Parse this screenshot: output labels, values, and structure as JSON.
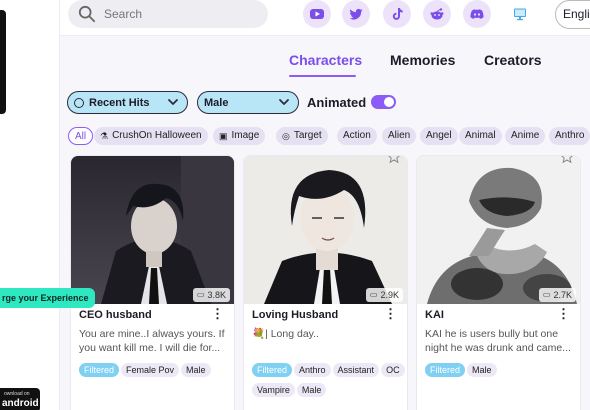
{
  "sidebar": {
    "promo_text": "rge your Experience",
    "android_small": "ownload on",
    "android_big": "android"
  },
  "search": {
    "placeholder": "Search"
  },
  "social_icons": [
    "youtube-icon",
    "twitter-icon",
    "tiktok-icon",
    "reddit-icon",
    "discord-icon",
    "desktop-icon"
  ],
  "language": "English",
  "tabs": [
    {
      "label": "Characters",
      "active": true
    },
    {
      "label": "Memories",
      "active": false
    },
    {
      "label": "Creators",
      "active": false
    }
  ],
  "filters": {
    "sort_label": "Recent Hits",
    "gender_label": "Male",
    "animated_label": "Animated",
    "animated_on": true
  },
  "chips": [
    {
      "label": "All",
      "icon": ""
    },
    {
      "label": "CrushOn Halloween",
      "icon": "⚗"
    },
    {
      "label": "Image",
      "icon": "▣"
    },
    {
      "label": "Target",
      "icon": "◎"
    },
    {
      "label": "Action",
      "icon": ""
    },
    {
      "label": "Alien",
      "icon": ""
    },
    {
      "label": "Angel",
      "icon": ""
    },
    {
      "label": "Animal",
      "icon": ""
    },
    {
      "label": "Anime",
      "icon": ""
    },
    {
      "label": "Anthro",
      "icon": ""
    }
  ],
  "cards": [
    {
      "title": "CEO husband",
      "messages": "3.8K",
      "description": "You are mine..I always yours. If you want kill me. I will die for...",
      "tags": [
        "Filtered",
        "Female Pov",
        "Male"
      ]
    },
    {
      "title": "Loving Husband",
      "messages": "2.9K",
      "description": "💐| Long day..",
      "tags": [
        "Filtered",
        "Anthro",
        "Assistant",
        "OC",
        "Vampire",
        "Male"
      ]
    },
    {
      "title": "KAI",
      "messages": "2.7K",
      "description": "KAI he is users bully but one night he was drunk and came...",
      "tags": [
        "Filtered",
        "Male"
      ]
    }
  ],
  "colors": {
    "accent": "#8b5cf6",
    "filter_bg": "#b9e6f7",
    "filtered_tag": "#7fd0f2",
    "promo": "#2ee8c2"
  }
}
